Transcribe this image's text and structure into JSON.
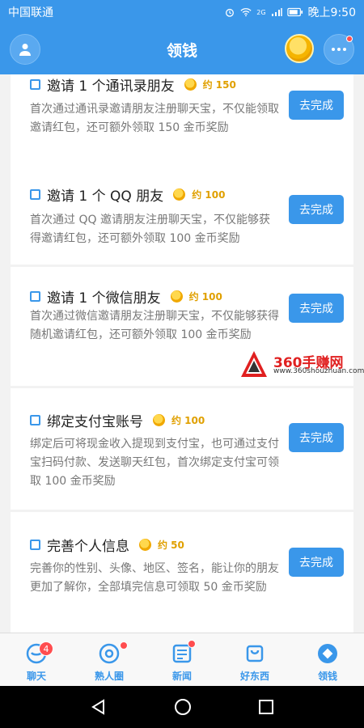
{
  "status_bar": {
    "carrier": "中国联通",
    "signal_label": "2G",
    "time": "晚上9:50"
  },
  "header": {
    "title": "领钱"
  },
  "tasks": [
    {
      "title": "邀请 1 个通讯录朋友",
      "reward": "约 150",
      "description": "首次通过通讯录邀请朋友注册聊天宝，不仅能领取邀请红包，还可额外领取 150 金币奖励",
      "button_label": "去完成"
    },
    {
      "title": "邀请 1 个 QQ 朋友",
      "reward": "约 100",
      "description": "首次通过 QQ 邀请朋友注册聊天宝，不仅能够获得邀请红包，还可额外领取 100 金币奖励",
      "button_label": "去完成"
    },
    {
      "title": "邀请 1 个微信朋友",
      "reward": "约 100",
      "description": "首次通过微信邀请朋友注册聊天宝，不仅能够获得随机邀请红包，还可额外领取 100 金币奖励",
      "button_label": "去完成"
    },
    {
      "title": "绑定支付宝账号",
      "reward": "约 100",
      "description": "绑定后可将现金收入提现到支付宝，也可通过支付宝扫码付款、发送聊天红包，首次绑定支付宝可领取 100 金币奖励",
      "button_label": "去完成"
    },
    {
      "title": "完善个人信息",
      "reward": "约 50",
      "description": "完善你的性别、头像、地区、签名，能让你的朋友更加了解你，全部填完信息可领取 50 金币奖励",
      "button_label": "去完成"
    }
  ],
  "watermark": {
    "title": "360手赚网",
    "url": "www.360shouzhuan.com"
  },
  "tabs": [
    {
      "label": "聊天",
      "badge": "4"
    },
    {
      "label": "熟人圈"
    },
    {
      "label": "新闻"
    },
    {
      "label": "好东西"
    },
    {
      "label": "领钱"
    }
  ],
  "colors": {
    "primary": "#3a97ea",
    "reward": "#e0a000",
    "badge": "#ff4d4f"
  }
}
